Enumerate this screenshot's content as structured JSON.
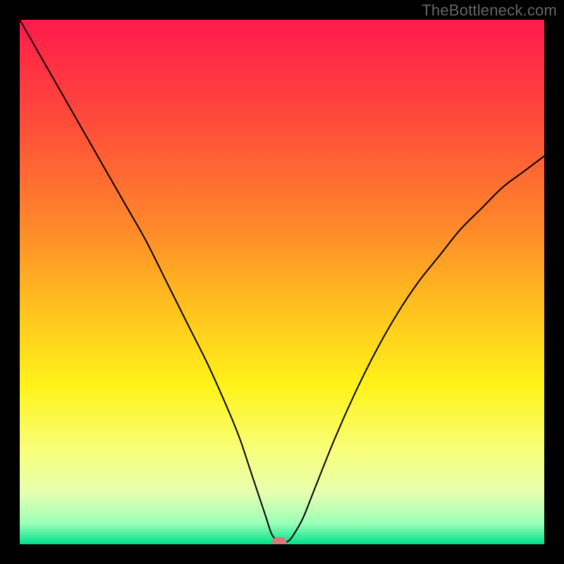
{
  "watermark": "TheBottleneck.com",
  "chart_data": {
    "type": "line",
    "title": "",
    "xlabel": "",
    "ylabel": "",
    "xlim": [
      0,
      100
    ],
    "ylim": [
      0,
      100
    ],
    "grid": false,
    "background_gradient": {
      "stops": [
        {
          "offset": 0,
          "color": "#ff1a4b"
        },
        {
          "offset": 20,
          "color": "#ff4d3a"
        },
        {
          "offset": 40,
          "color": "#ff8a2a"
        },
        {
          "offset": 55,
          "color": "#ffc21f"
        },
        {
          "offset": 70,
          "color": "#fff31a"
        },
        {
          "offset": 82,
          "color": "#f8ff7a"
        },
        {
          "offset": 90,
          "color": "#e8ffb0"
        },
        {
          "offset": 96,
          "color": "#9cffb8"
        },
        {
          "offset": 100,
          "color": "#00e08a"
        }
      ]
    },
    "series": [
      {
        "name": "bottleneck-curve",
        "color": "#000000",
        "x": [
          0,
          4,
          8,
          12,
          16,
          20,
          24,
          28,
          32,
          36,
          40,
          42,
          44,
          46,
          47,
          48,
          49,
          50,
          51,
          52,
          54,
          56,
          60,
          64,
          68,
          72,
          76,
          80,
          84,
          88,
          92,
          96,
          100
        ],
        "y": [
          100,
          93,
          86,
          79,
          72,
          65,
          58,
          50,
          42,
          34,
          25,
          20,
          14,
          8,
          5,
          2,
          0.8,
          0.5,
          0.5,
          1.5,
          5,
          10,
          20,
          29,
          37,
          44,
          50,
          55,
          60,
          64,
          68,
          71,
          74
        ]
      }
    ],
    "marker": {
      "name": "optimal-point",
      "x": 49.5,
      "y": 0.5,
      "color": "#d47a7a",
      "rx": 1.4,
      "ry": 0.9
    }
  }
}
